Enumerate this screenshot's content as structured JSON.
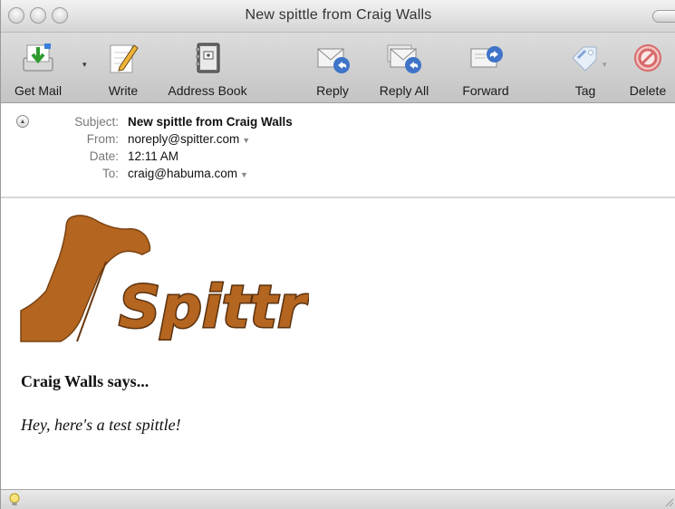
{
  "window": {
    "title": "New spittle from Craig Walls"
  },
  "toolbar": {
    "get_mail": "Get Mail",
    "write": "Write",
    "address_book": "Address Book",
    "reply": "Reply",
    "reply_all": "Reply All",
    "forward": "Forward",
    "tag": "Tag",
    "delete": "Delete"
  },
  "header": {
    "subject_label": "Subject:",
    "subject": "New spittle from Craig Walls",
    "from_label": "From:",
    "from": "noreply@spitter.com",
    "date_label": "Date:",
    "date": "12:11 AM",
    "to_label": "To:",
    "to": "craig@habuma.com"
  },
  "message": {
    "logo_text": "Spittr",
    "says": "Craig Walls says...",
    "spittle": "Hey, here's a test spittle!"
  },
  "colors": {
    "logo_brown": "#b4651f",
    "logo_outline": "#5a3210"
  }
}
